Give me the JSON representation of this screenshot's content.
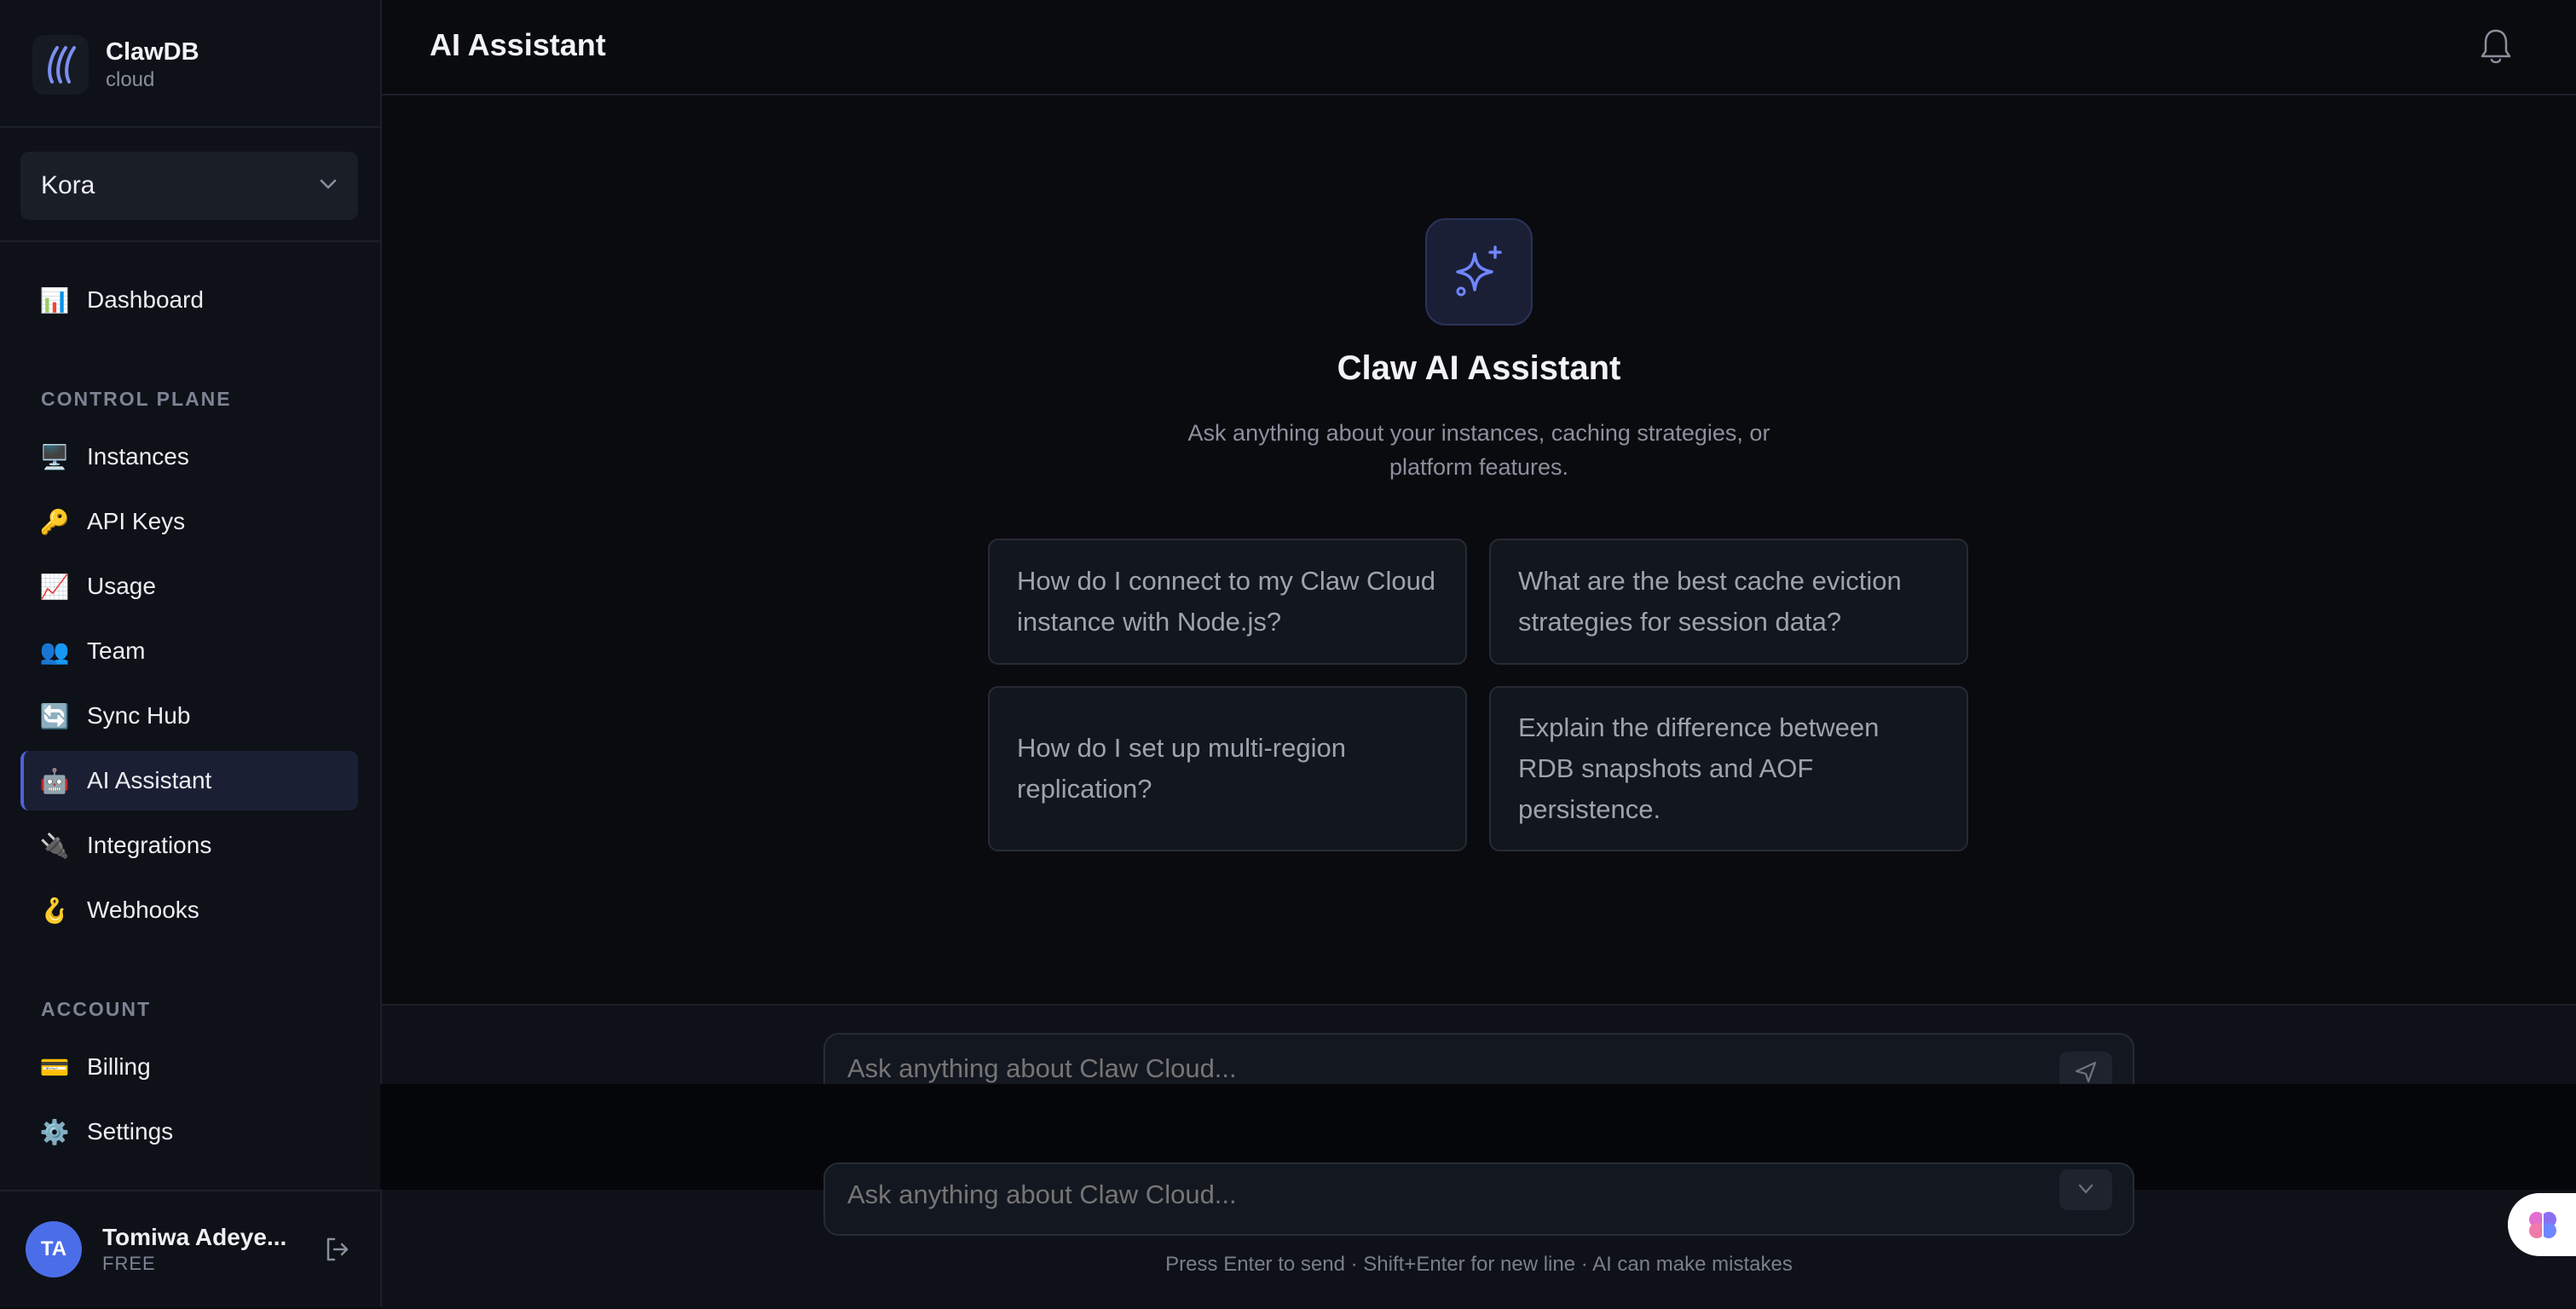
{
  "brand": {
    "name": "ClawDB",
    "sub": "cloud"
  },
  "org": {
    "name": "Kora"
  },
  "nav": {
    "dashboard": {
      "label": "Dashboard",
      "icon": "📊"
    },
    "control_plane_label": "CONTROL PLANE",
    "instances": {
      "label": "Instances",
      "icon": "🖥️"
    },
    "api_keys": {
      "label": "API Keys",
      "icon": "🔑"
    },
    "usage": {
      "label": "Usage",
      "icon": "📈"
    },
    "team": {
      "label": "Team",
      "icon": "👥"
    },
    "sync_hub": {
      "label": "Sync Hub",
      "icon": "🔄"
    },
    "ai_assistant": {
      "label": "AI Assistant",
      "icon": "🤖"
    },
    "integrations": {
      "label": "Integrations",
      "icon": "🔌"
    },
    "webhooks": {
      "label": "Webhooks",
      "icon": "🪝"
    },
    "account_label": "ACCOUNT",
    "billing": {
      "label": "Billing",
      "icon": "💳"
    },
    "settings": {
      "label": "Settings",
      "icon": "⚙️"
    }
  },
  "user": {
    "initials": "TA",
    "name": "Tomiwa Adeye...",
    "plan": "FREE"
  },
  "header": {
    "title": "AI Assistant"
  },
  "hero": {
    "title": "Claw AI Assistant",
    "subtitle": "Ask anything about your instances, caching strategies, or platform features."
  },
  "suggestions": [
    "How do I connect to my Claw Cloud instance with Node.js?",
    "What are the best cache eviction strategies for session data?",
    "How do I set up multi-region replication?",
    "Explain the difference between RDB snapshots and AOF persistence."
  ],
  "composer": {
    "placeholder": "Ask anything about Claw Cloud...",
    "hint": "Press Enter to send · Shift+Enter for new line · AI can make mistakes"
  },
  "colors": {
    "accent": "#4f63d8",
    "background": "#0a0b0f",
    "sidebar": "#0e1118"
  }
}
